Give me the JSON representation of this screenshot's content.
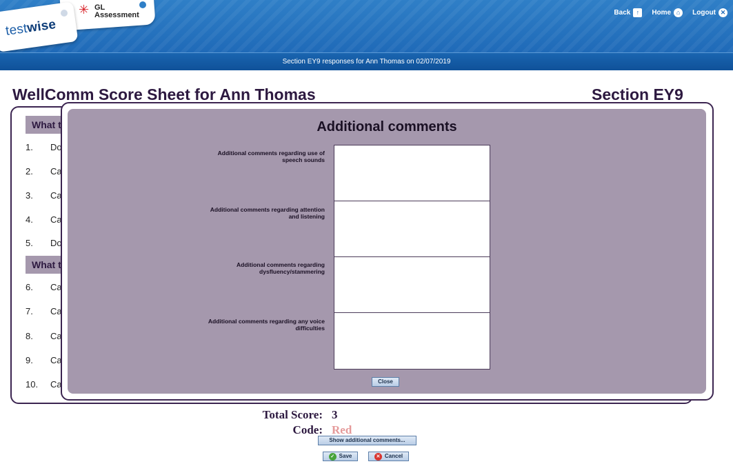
{
  "header": {
    "brand": "testwise",
    "brand_prefix": "test",
    "brand_suffix": "wise",
    "partner_line1": "GL",
    "partner_line2": "Assessment",
    "nav": [
      {
        "label": "Back",
        "icon": "up-arrow-icon"
      },
      {
        "label": "Home",
        "icon": "home-icon"
      },
      {
        "label": "Logout",
        "icon": "close-icon"
      }
    ],
    "subtitle": "Section EY9 responses for Ann Thomas on 02/07/2019"
  },
  "page": {
    "title": "WellComm Score Sheet for Ann Thomas",
    "section": "Section EY9"
  },
  "sheet": {
    "headings": [
      "What t",
      "What t"
    ],
    "questions": [
      {
        "num": "1.",
        "text": "Do"
      },
      {
        "num": "2.",
        "text": "Ca"
      },
      {
        "num": "3.",
        "text": "Ca"
      },
      {
        "num": "4.",
        "text": "Ca"
      },
      {
        "num": "5.",
        "text": "Do"
      },
      {
        "num": "6.",
        "text": "Ca"
      },
      {
        "num": "7.",
        "text": "Ca"
      },
      {
        "num": "8.",
        "text": "Ca"
      },
      {
        "num": "9.",
        "text": "Ca"
      },
      {
        "num": "10.",
        "text": "Ca"
      }
    ]
  },
  "modal": {
    "title": "Additional comments",
    "fields": [
      {
        "label": "Additional comments regarding use of speech sounds",
        "value": ""
      },
      {
        "label": "Additional comments regarding attention and listening",
        "value": ""
      },
      {
        "label": "Additional comments regarding dysfluency/stammering",
        "value": ""
      },
      {
        "label": "Additional comments regarding any voice difficulties",
        "value": ""
      }
    ],
    "close_label": "Close"
  },
  "footer": {
    "total_label": "Total Score:",
    "total_value": "3",
    "code_label": "Code:",
    "code_value": "Red",
    "code_color": "#e59a9a",
    "show_comments_label": "Show additional comments...",
    "save_label": "Save",
    "cancel_label": "Cancel"
  },
  "colors": {
    "header_blue": "#1f6ab8",
    "panel_border": "#3b2450",
    "modal_bg": "#a598ad",
    "title_text": "#2d1940"
  }
}
